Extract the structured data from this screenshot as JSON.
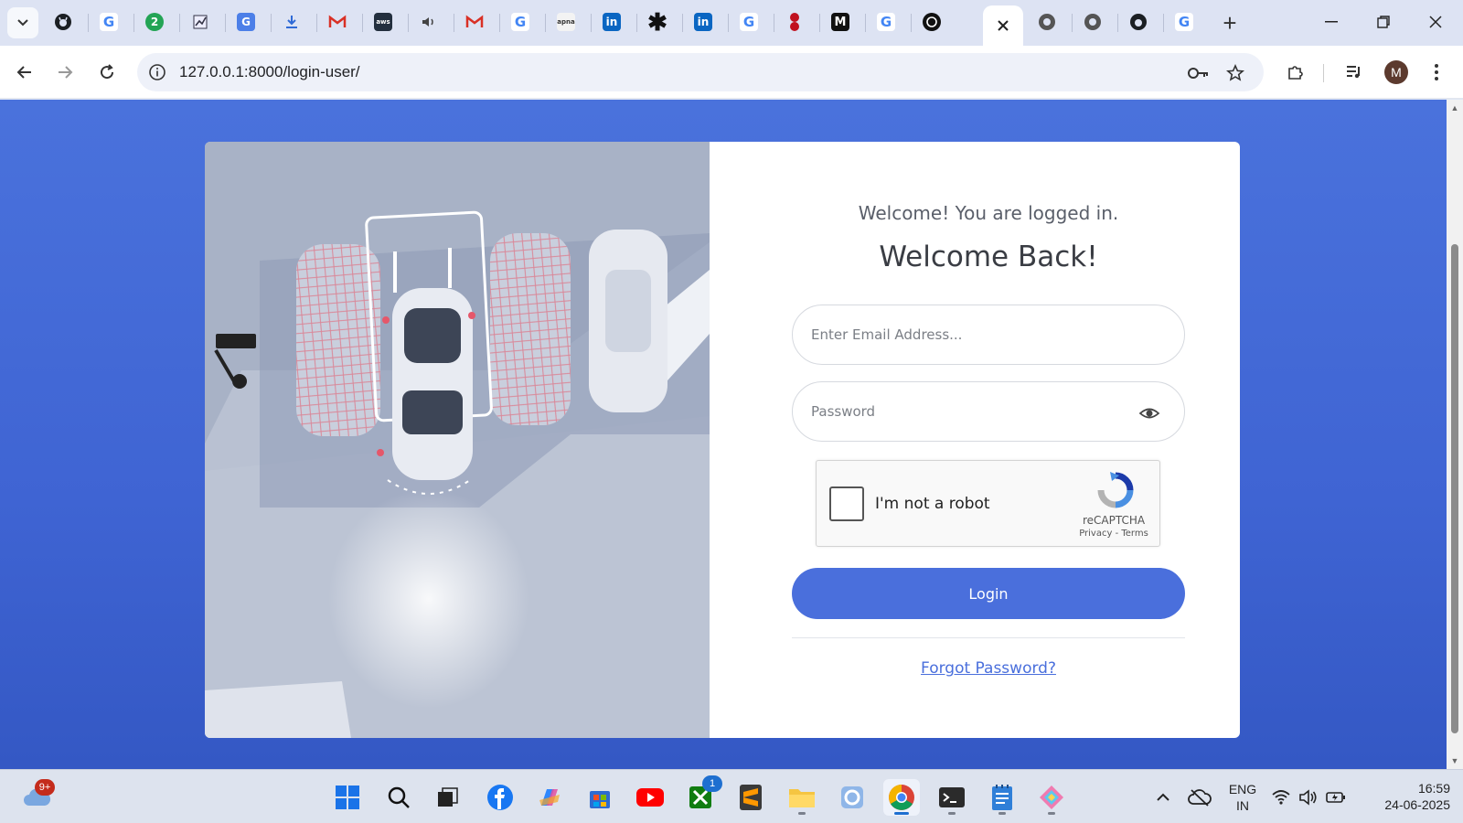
{
  "browser": {
    "tabs": [
      {
        "icon": "github-icon"
      },
      {
        "icon": "google-icon"
      },
      {
        "icon": "green-badge-icon",
        "text": "2"
      },
      {
        "icon": "chart-icon"
      },
      {
        "icon": "translate-icon"
      },
      {
        "icon": "download-icon"
      },
      {
        "icon": "gmail-icon"
      },
      {
        "icon": "aws-icon",
        "text": "aws"
      },
      {
        "icon": "audio-icon"
      },
      {
        "icon": "gmail-icon"
      },
      {
        "icon": "google-icon"
      },
      {
        "icon": "apna-icon",
        "text": "apna"
      },
      {
        "icon": "linkedin-icon",
        "text": "in"
      },
      {
        "icon": "asterisk-icon"
      },
      {
        "icon": "linkedin-icon",
        "text": "in"
      },
      {
        "icon": "google-icon"
      },
      {
        "icon": "red-dots-icon"
      },
      {
        "icon": "medium-icon",
        "text": "M"
      },
      {
        "icon": "google-icon"
      },
      {
        "icon": "openai-icon"
      },
      {
        "icon": "close-icon"
      },
      {
        "icon": "chrome-icon"
      },
      {
        "icon": "chrome-icon"
      },
      {
        "icon": "github-icon"
      },
      {
        "icon": "google-icon"
      }
    ],
    "url": "127.0.0.1:8000/login-user/",
    "avatar_letter": "M"
  },
  "login": {
    "status_message": "Welcome! You are logged in.",
    "title": "Welcome Back!",
    "email_placeholder": "Enter Email Address...",
    "password_placeholder": "Password",
    "recaptcha": {
      "label": "I'm not a robot",
      "brand": "reCAPTCHA",
      "links": "Privacy - Terms"
    },
    "login_button": "Login",
    "forgot_link": "Forgot Password?"
  },
  "colors": {
    "page_background": "#4a72dc",
    "accent": "#4a6fdc",
    "card": "#ffffff"
  },
  "taskbar": {
    "weather_badge": "9+",
    "xbox_badge": "1",
    "language_primary": "ENG",
    "language_secondary": "IN",
    "time": "16:59",
    "date": "24-06-2025"
  }
}
